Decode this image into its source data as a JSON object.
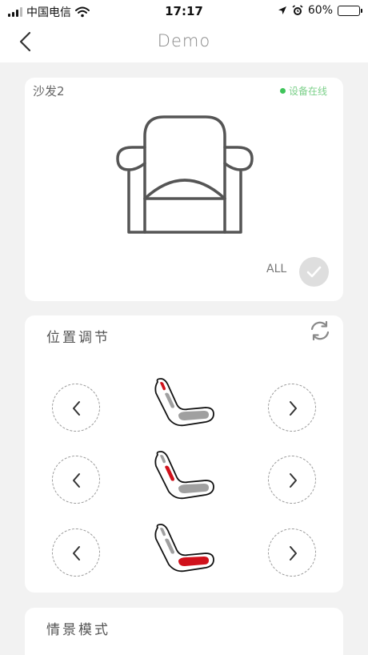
{
  "status_bar": {
    "carrier": "中国电信",
    "time": "17:17",
    "battery_text": "60%",
    "battery_level": 0.6,
    "icons": [
      "signal-icon",
      "wifi-icon",
      "location-icon",
      "alarm-icon",
      "battery-icon"
    ]
  },
  "nav": {
    "title": "Demo",
    "back_icon": "chevron-left-icon"
  },
  "device": {
    "name": "沙发2",
    "status": "设备在线",
    "status_color": "#3fc45a",
    "all_label": "ALL",
    "image": "sofa-icon",
    "check_icon": "check-icon"
  },
  "position": {
    "title": "位置调节",
    "refresh_icon": "refresh-icon",
    "rows": [
      {
        "part": "head",
        "left_icon": "chevron-left-icon",
        "right_icon": "chevron-right-icon"
      },
      {
        "part": "back",
        "left_icon": "chevron-left-icon",
        "right_icon": "chevron-right-icon"
      },
      {
        "part": "seat",
        "left_icon": "chevron-left-icon",
        "right_icon": "chevron-right-icon"
      }
    ],
    "highlight_color": "#d0111b",
    "inactive_color": "#a0a0a0"
  },
  "scene": {
    "title": "情景模式"
  }
}
